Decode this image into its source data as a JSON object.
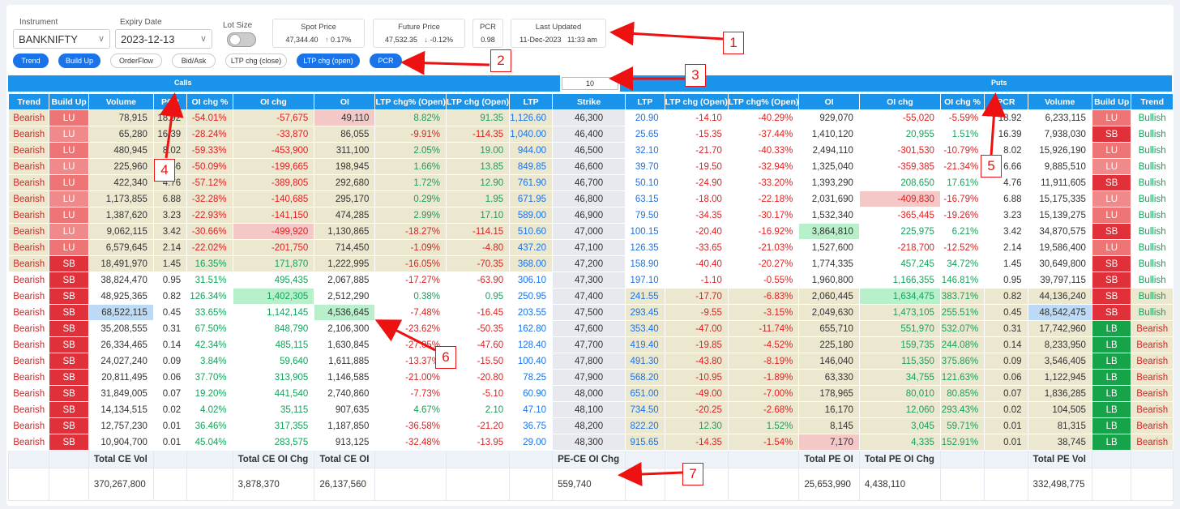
{
  "controls": {
    "instrument_label": "Instrument",
    "instrument_value": "BANKNIFTY",
    "expiry_label": "Expiry Date",
    "expiry_value": "2023-12-13",
    "lotsize_label": "Lot Size"
  },
  "cards": {
    "spot_title": "Spot Price",
    "spot_value": "47,344.40",
    "spot_arrow": "↑",
    "spot_change": "0.17%",
    "future_title": "Future Price",
    "future_value": "47,532.35",
    "future_arrow": "↓",
    "future_change": "-0.12%",
    "pcr_title": "PCR",
    "pcr_value": "0.98",
    "updated_title": "Last Updated",
    "updated_value": "11-Dec-2023   11:33 am"
  },
  "pills": [
    "Trend",
    "Build Up",
    "OrderFlow",
    "Bid/Ask",
    "LTP chg (close)",
    "LTP chg (open)",
    "PCR"
  ],
  "bars": {
    "calls": "Calls",
    "puts": "Puts",
    "strike_input": "10"
  },
  "headers": [
    "Trend",
    "Build Up",
    "Volume",
    "PCR",
    "OI chg %",
    "OI chg",
    "OI",
    "LTP chg% (Open)",
    "LTP chg (Open)",
    "LTP",
    "Strike",
    "LTP",
    "LTP chg (Open)",
    "LTP chg% (Open)",
    "OI",
    "OI chg",
    "OI chg %",
    "PCR",
    "Volume",
    "Build Up",
    "Trend"
  ],
  "rows": [
    [
      "Bearish",
      "LU",
      "78,915",
      "18.92",
      "-54.01%",
      "-57,675",
      "49,110",
      "8.82%",
      "91.35",
      "1,126.60",
      "46,300",
      "20.90",
      "-14.10",
      "-40.29%",
      "929,070",
      "-55,020",
      "-5.59%",
      "18.92",
      "6,233,115",
      "LU",
      "Bullish"
    ],
    [
      "Bearish",
      "LU",
      "65,280",
      "16.39",
      "-28.24%",
      "-33,870",
      "86,055",
      "-9.91%",
      "-114.35",
      "1,040.00",
      "46,400",
      "25.65",
      "-15.35",
      "-37.44%",
      "1,410,120",
      "20,955",
      "1.51%",
      "16.39",
      "7,938,030",
      "SB",
      "Bullish"
    ],
    [
      "Bearish",
      "LU",
      "480,945",
      "8.02",
      "-59.33%",
      "-453,900",
      "311,100",
      "2.05%",
      "19.00",
      "944.00",
      "46,500",
      "32.10",
      "-21.70",
      "-40.33%",
      "2,494,110",
      "-301,530",
      "-10.79%",
      "8.02",
      "15,926,190",
      "LU",
      "Bullish"
    ],
    [
      "Bearish",
      "LU",
      "225,960",
      "6.66",
      "-50.09%",
      "-199,665",
      "198,945",
      "1.66%",
      "13.85",
      "849.85",
      "46,600",
      "39.70",
      "-19.50",
      "-32.94%",
      "1,325,040",
      "-359,385",
      "-21.34%",
      "6.66",
      "9,885,510",
      "LU",
      "Bullish"
    ],
    [
      "Bearish",
      "LU",
      "422,340",
      "4.76",
      "-57.12%",
      "-389,805",
      "292,680",
      "1.72%",
      "12.90",
      "761.90",
      "46,700",
      "50.10",
      "-24.90",
      "-33.20%",
      "1,393,290",
      "208,650",
      "17.61%",
      "4.76",
      "11,911,605",
      "SB",
      "Bullish"
    ],
    [
      "Bearish",
      "LU",
      "1,173,855",
      "6.88",
      "-32.28%",
      "-140,685",
      "295,170",
      "0.29%",
      "1.95",
      "671.95",
      "46,800",
      "63.15",
      "-18.00",
      "-22.18%",
      "2,031,690",
      "-409,830",
      "-16.79%",
      "6.88",
      "15,175,335",
      "LU",
      "Bullish"
    ],
    [
      "Bearish",
      "LU",
      "1,387,620",
      "3.23",
      "-22.93%",
      "-141,150",
      "474,285",
      "2.99%",
      "17.10",
      "589.00",
      "46,900",
      "79.50",
      "-34.35",
      "-30.17%",
      "1,532,340",
      "-365,445",
      "-19.26%",
      "3.23",
      "15,139,275",
      "LU",
      "Bullish"
    ],
    [
      "Bearish",
      "LU",
      "9,062,115",
      "3.42",
      "-30.66%",
      "-499,920",
      "1,130,865",
      "-18.27%",
      "-114.15",
      "510.60",
      "47,000",
      "100.15",
      "-20.40",
      "-16.92%",
      "3,864,810",
      "225,975",
      "6.21%",
      "3.42",
      "34,870,575",
      "SB",
      "Bullish"
    ],
    [
      "Bearish",
      "LU",
      "6,579,645",
      "2.14",
      "-22.02%",
      "-201,750",
      "714,450",
      "-1.09%",
      "-4.80",
      "437.20",
      "47,100",
      "126.35",
      "-33.65",
      "-21.03%",
      "1,527,600",
      "-218,700",
      "-12.52%",
      "2.14",
      "19,586,400",
      "LU",
      "Bullish"
    ],
    [
      "Bearish",
      "SB",
      "18,491,970",
      "1.45",
      "16.35%",
      "171,870",
      "1,222,995",
      "-16.05%",
      "-70.35",
      "368.00",
      "47,200",
      "158.90",
      "-40.40",
      "-20.27%",
      "1,774,335",
      "457,245",
      "34.72%",
      "1.45",
      "30,649,800",
      "SB",
      "Bullish"
    ],
    [
      "Bearish",
      "SB",
      "38,824,470",
      "0.95",
      "31.51%",
      "495,435",
      "2,067,885",
      "-17.27%",
      "-63.90",
      "306.10",
      "47,300",
      "197.10",
      "-1.10",
      "-0.55%",
      "1,960,800",
      "1,166,355",
      "146.81%",
      "0.95",
      "39,797,115",
      "SB",
      "Bullish"
    ],
    [
      "Bearish",
      "SB",
      "48,925,365",
      "0.82",
      "126.34%",
      "1,402,305",
      "2,512,290",
      "0.38%",
      "0.95",
      "250.95",
      "47,400",
      "241.55",
      "-17.70",
      "-6.83%",
      "2,060,445",
      "1,634,475",
      "383.71%",
      "0.82",
      "44,136,240",
      "SB",
      "Bullish"
    ],
    [
      "Bearish",
      "SB",
      "68,522,115",
      "0.45",
      "33.65%",
      "1,142,145",
      "4,536,645",
      "-7.48%",
      "-16.45",
      "203.55",
      "47,500",
      "293.45",
      "-9.55",
      "-3.15%",
      "2,049,630",
      "1,473,105",
      "255.51%",
      "0.45",
      "48,542,475",
      "SB",
      "Bullish"
    ],
    [
      "Bearish",
      "SB",
      "35,208,555",
      "0.31",
      "67.50%",
      "848,790",
      "2,106,300",
      "-23.62%",
      "-50.35",
      "162.80",
      "47,600",
      "353.40",
      "-47.00",
      "-11.74%",
      "655,710",
      "551,970",
      "532.07%",
      "0.31",
      "17,742,960",
      "LB",
      "Bearish"
    ],
    [
      "Bearish",
      "SB",
      "26,334,465",
      "0.14",
      "42.34%",
      "485,115",
      "1,630,845",
      "-27.05%",
      "-47.60",
      "128.40",
      "47,700",
      "419.40",
      "-19.85",
      "-4.52%",
      "225,180",
      "159,735",
      "244.08%",
      "0.14",
      "8,233,950",
      "LB",
      "Bearish"
    ],
    [
      "Bearish",
      "SB",
      "24,027,240",
      "0.09",
      "3.84%",
      "59,640",
      "1,611,885",
      "-13.37%",
      "-15.50",
      "100.40",
      "47,800",
      "491.30",
      "-43.80",
      "-8.19%",
      "146,040",
      "115,350",
      "375.86%",
      "0.09",
      "3,546,405",
      "LB",
      "Bearish"
    ],
    [
      "Bearish",
      "SB",
      "20,811,495",
      "0.06",
      "37.70%",
      "313,905",
      "1,146,585",
      "-21.00%",
      "-20.80",
      "78.25",
      "47,900",
      "568.20",
      "-10.95",
      "-1.89%",
      "63,330",
      "34,755",
      "121.63%",
      "0.06",
      "1,122,945",
      "LB",
      "Bearish"
    ],
    [
      "Bearish",
      "SB",
      "31,849,005",
      "0.07",
      "19.20%",
      "441,540",
      "2,740,860",
      "-7.73%",
      "-5.10",
      "60.90",
      "48,000",
      "651.00",
      "-49.00",
      "-7.00%",
      "178,965",
      "80,010",
      "80.85%",
      "0.07",
      "1,836,285",
      "LB",
      "Bearish"
    ],
    [
      "Bearish",
      "SB",
      "14,134,515",
      "0.02",
      "4.02%",
      "35,115",
      "907,635",
      "4.67%",
      "2.10",
      "47.10",
      "48,100",
      "734.50",
      "-20.25",
      "-2.68%",
      "16,170",
      "12,060",
      "293.43%",
      "0.02",
      "104,505",
      "LB",
      "Bearish"
    ],
    [
      "Bearish",
      "SB",
      "12,757,230",
      "0.01",
      "36.46%",
      "317,355",
      "1,187,850",
      "-36.58%",
      "-21.20",
      "36.75",
      "48,200",
      "822.20",
      "12.30",
      "1.52%",
      "8,145",
      "3,045",
      "59.71%",
      "0.01",
      "81,315",
      "LB",
      "Bearish"
    ],
    [
      "Bearish",
      "SB",
      "10,904,700",
      "0.01",
      "45.04%",
      "283,575",
      "913,125",
      "-32.48%",
      "-13.95",
      "29.00",
      "48,300",
      "915.65",
      "-14.35",
      "-1.54%",
      "7,170",
      "4,335",
      "152.91%",
      "0.01",
      "38,745",
      "LB",
      "Bearish"
    ]
  ],
  "totals": {
    "total_ce_vol_label": "Total CE Vol",
    "total_ce_vol": "370,267,800",
    "total_ce_oichg_label": "Total CE OI Chg",
    "total_ce_oichg": "3,878,370",
    "total_ce_oi_label": "Total CE OI",
    "total_ce_oi": "26,137,560",
    "pe_ce_label": "PE-CE OI Chg",
    "pe_ce": "559,740",
    "total_pe_oi_label": "Total PE OI",
    "total_pe_oi": "25,653,990",
    "total_pe_oichg_label": "Total PE OI Chg",
    "total_pe_oichg": "4,438,110",
    "total_pe_vol_label": "Total PE Vol",
    "total_pe_vol": "332,498,775"
  },
  "annotations": [
    "1",
    "2",
    "3",
    "4",
    "5",
    "6",
    "7"
  ],
  "colors": {
    "accent": "#1a94ea",
    "bearish": "#e02020",
    "bullish": "#13a35a",
    "ltp_blue": "#1a73e8",
    "sb": "#e0303a",
    "lu": "#ee7575",
    "lb": "#17a34a",
    "otm": "#ece7cf",
    "arrow": "#e11111"
  }
}
